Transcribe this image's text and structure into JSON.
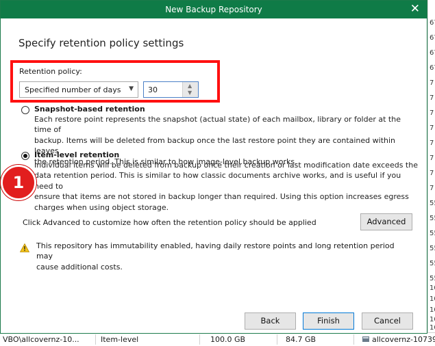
{
  "background": {
    "right_column": [
      "67",
      "67",
      "67",
      "67",
      "7",
      "7",
      "7",
      "7",
      "7",
      "7",
      "7",
      "7",
      "55",
      "55",
      "55",
      "55",
      "55",
      "55",
      "10",
      "10",
      "10",
      "10",
      "10"
    ],
    "bottom_row": {
      "path": "VBO\\allcovernz-10...",
      "type": "Item-level",
      "size1": "100.0 GB",
      "size2": "84.7 GB",
      "repo": "allcovernz-10739"
    }
  },
  "dialog": {
    "title": "New Backup Repository",
    "close_glyph": "✕",
    "heading": "Specify retention policy settings",
    "retention": {
      "label": "Retention policy:",
      "type_value": "Specified number of days",
      "days_value": "30"
    },
    "options": {
      "snapshot": {
        "title": "Snapshot-based retention",
        "lines": [
          "Each restore point represents the snapshot (actual state) of each mailbox, library or folder at the time of",
          "backup. Items will be deleted from backup once the last restore point they are contained within leaves",
          "the retention period. This is similar to how image-level backup works."
        ],
        "selected": false
      },
      "item_level": {
        "title": "Item-level retention",
        "lines": [
          "Individual items will be deleted from backup once their creation or last modification date exceeds the",
          "data retention period. This is similar to how classic documents archive works, and is useful if you need to",
          "ensure that items are not stored in backup longer than required. Using this option increases egress",
          "charges when using object storage."
        ],
        "selected": true
      }
    },
    "badge_number": "1",
    "advanced_text": "Click Advanced to customize how often the retention policy should be applied",
    "advanced_button": "Advanced",
    "warning": {
      "icon": "warning-icon",
      "line1": "This repository has immutability enabled, having daily restore points and long retention period may",
      "line2": "cause additional costs."
    },
    "buttons": {
      "back": "Back",
      "finish": "Finish",
      "cancel": "Cancel"
    },
    "colors": {
      "titlebar": "#0f7b47",
      "highlight_box": "#ff1010",
      "badge": "#e21e1e"
    }
  }
}
